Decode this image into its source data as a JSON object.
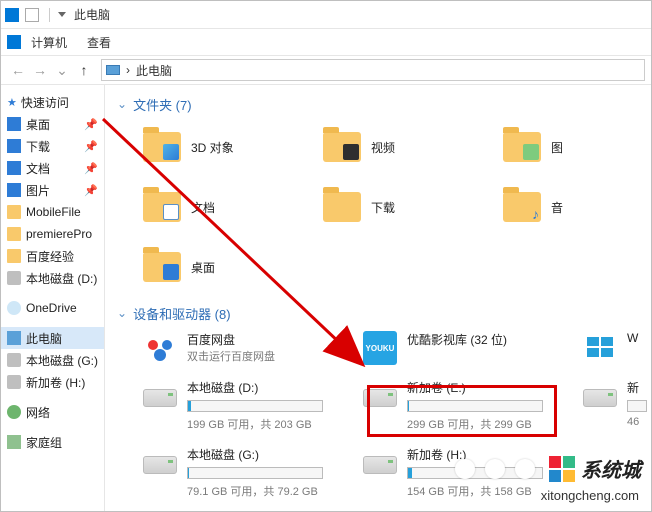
{
  "titlebar": {
    "title": "此电脑"
  },
  "menu": {
    "computer": "计算机",
    "view": "查看"
  },
  "address": {
    "root": "此电脑",
    "sep": "›"
  },
  "sidebar": {
    "quick_access": "快速访问",
    "items": [
      {
        "label": "桌面",
        "pinned": true
      },
      {
        "label": "下载",
        "pinned": true
      },
      {
        "label": "文档",
        "pinned": true
      },
      {
        "label": "图片",
        "pinned": true
      },
      {
        "label": "MobileFile",
        "pinned": false
      },
      {
        "label": "premierePro",
        "pinned": false
      },
      {
        "label": "百度经验",
        "pinned": false
      },
      {
        "label": "本地磁盘 (D:)",
        "pinned": false
      }
    ],
    "onedrive": "OneDrive",
    "this_pc": "此电脑",
    "drives": [
      {
        "label": "本地磁盘 (G:)"
      },
      {
        "label": "新加卷 (H:)"
      }
    ],
    "network": "网络",
    "homegroup": "家庭组"
  },
  "folders": {
    "header": "文件夹 (7)",
    "items": [
      {
        "name": "3D 对象",
        "sub": "obj3d"
      },
      {
        "name": "视频",
        "sub": "video"
      },
      {
        "name": "图",
        "sub": "pic"
      },
      {
        "name": "文档",
        "sub": "doc"
      },
      {
        "name": "下载",
        "sub": ""
      },
      {
        "name": "音",
        "sub": "music"
      },
      {
        "name": "桌面",
        "sub": "desk"
      }
    ]
  },
  "drives": {
    "header": "设备和驱动器 (8)",
    "items": [
      {
        "name": "百度网盘",
        "sub": "双击运行百度网盘",
        "type": "bdy"
      },
      {
        "name": "优酷影视库 (32 位)",
        "sub": "",
        "type": "youku",
        "badge": "YOUKU"
      },
      {
        "name": "W",
        "sub": "",
        "type": "win"
      },
      {
        "name": "本地磁盘 (D:)",
        "type": "drive",
        "free": "199 GB 可用，共 203 GB",
        "fill": 2
      },
      {
        "name": "新加卷 (E:)",
        "type": "drive",
        "free": "299 GB 可用，共 299 GB",
        "fill": 0
      },
      {
        "name": "新",
        "type": "drive",
        "free": "46",
        "fill": 0
      },
      {
        "name": "本地磁盘 (G:)",
        "type": "drive",
        "free": "79.1 GB 可用，共 79.2 GB",
        "fill": 0
      },
      {
        "name": "新加卷 (H:)",
        "type": "drive",
        "free": "154 GB 可用，共 158 GB",
        "fill": 3
      }
    ]
  },
  "watermark": {
    "text": "系统城",
    "url": "xitongcheng.com"
  }
}
